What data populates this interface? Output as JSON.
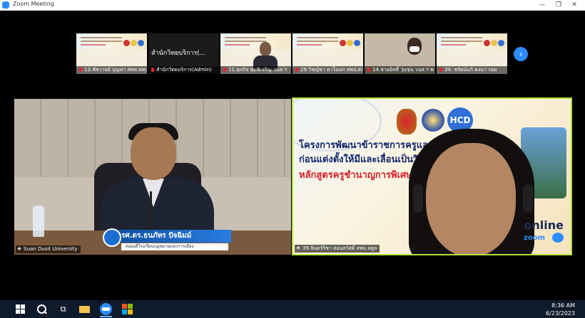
{
  "window": {
    "title": "Zoom Meeting",
    "controls": {
      "minimize": "—",
      "restore": "❐",
      "close": "✕"
    }
  },
  "gallery": {
    "participants": [
      {
        "name": "13.ชัชวาลย์ บุญทา สพท.ลพบุรี"
      },
      {
        "name": "สำนักวิทยบริการ(Admin)",
        "tile_label": "สำนักวิทยบริการ(..."
      },
      {
        "name": "11.สุภกิจ พุ่มพิเจริญ วนส.ฯ"
      },
      {
        "name": "29.วิชญ์ชา หาโฉมก สพป.สก"
      },
      {
        "name": "14.ชายอิทธิ์ วุ่นชุน วนส.ฯ พ"
      },
      {
        "name": "34. ชรัตน์แก้ คงนา รอย"
      }
    ],
    "next_button": "›"
  },
  "main": {
    "left": {
      "name_tag": "Suan Dusit University",
      "caption_name": "รศ.ดร.ธนภัทร ปัจฉิมม์",
      "caption_title": "คณบดีโรงเรียนกฎหมายและการเมือง"
    },
    "right": {
      "name_tag": "39.จินตร์ริชา สอนสวัสดิ์ สพม.สตูล",
      "slide_line1": "โครงการพัฒนาข้าราชการครูและบุ",
      "slide_line2": "ก่อนแต่งตั้งให้มีและเลื่อนเป็นวิทย",
      "slide_line3": "หลักสูตรครูชำนาญการพิเศษ ระ",
      "logo_text": "HCD",
      "online_label": "online",
      "zoom_label": "zoom"
    }
  },
  "taskbar": {
    "time": "8:36 AM",
    "date": "6/23/2023",
    "taskview_glyph": "⧉"
  },
  "colors": {
    "zoom_blue": "#2d8cff",
    "active_speaker_border": "#b5e23a",
    "taskbar": "#0f1a2b"
  }
}
